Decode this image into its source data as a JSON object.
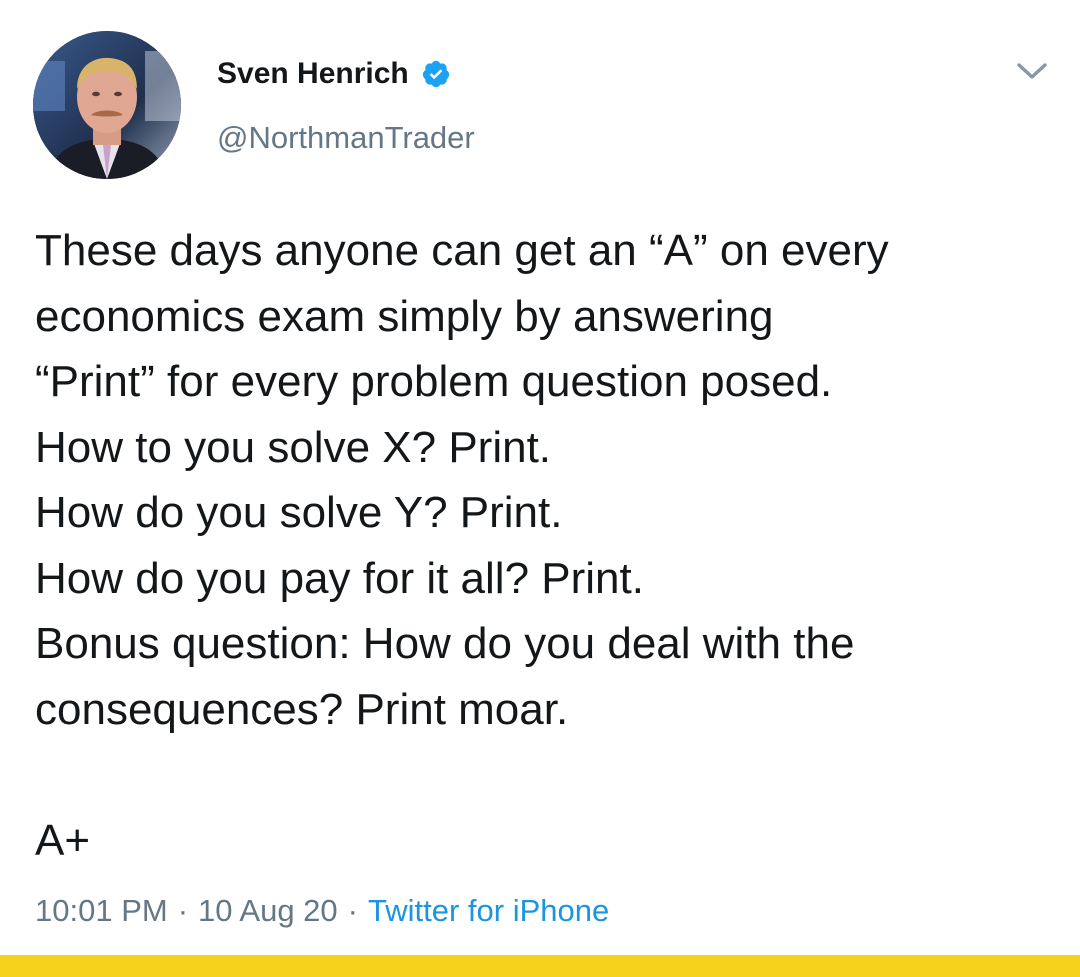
{
  "author": {
    "display_name": "Sven Henrich",
    "handle": "@NorthmanTrader",
    "verified": true,
    "avatar_icon": "profile-photo"
  },
  "tweet": {
    "lines": [
      "These days anyone can get an “A” on every",
      "economics exam simply by answering",
      "“Print” for every problem question posed.",
      "How to you solve X? Print.",
      "How do you solve Y? Print.",
      "How do you pay for it all? Print.",
      "Bonus question: How do you deal with the",
      "consequences? Print moar.",
      "",
      "A+"
    ],
    "time": "10:01 PM",
    "date": "10 Aug 20",
    "source": "Twitter for iPhone",
    "separator": "·"
  },
  "colors": {
    "text_primary": "#14171a",
    "text_secondary": "#657786",
    "link": "#1b95e0",
    "verified_badge": "#1da1f2",
    "bottom_bar": "#f7d21b"
  },
  "icons": {
    "verified": "verified-badge-icon",
    "menu": "chevron-down-icon"
  }
}
